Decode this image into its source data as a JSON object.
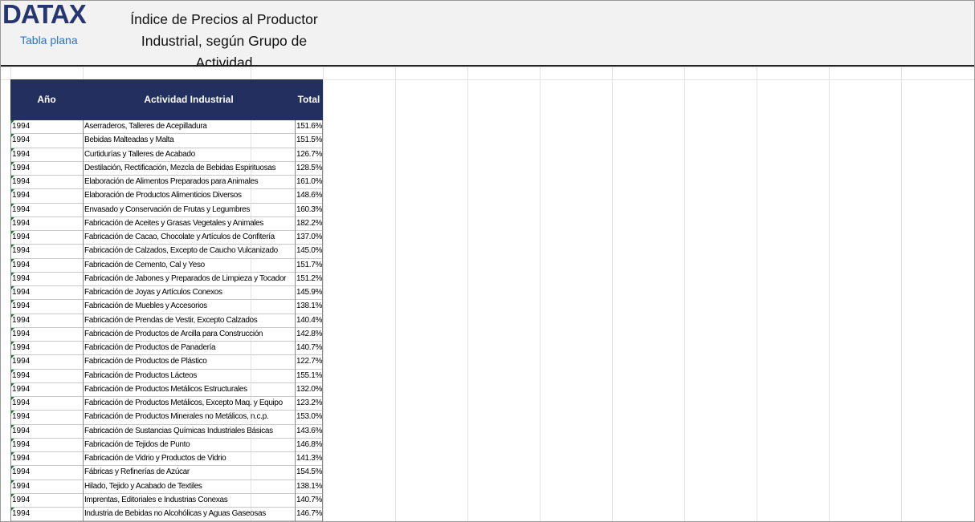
{
  "header": {
    "logo_text": "DATAX",
    "logo_subtitle": "Tabla plana",
    "title_line1": "Índice de Precios al Productor",
    "title_line2": "Industrial, según Grupo de Actividad"
  },
  "colors": {
    "header_band": "#f2f2f2",
    "table_header_bg": "#23305f",
    "logo_color": "#253670",
    "subtitle_color": "#2f71b7",
    "cell_marker": "#1e7a35"
  },
  "table": {
    "columns": [
      "Año",
      "Actividad Industrial",
      "Total"
    ],
    "rows": [
      {
        "year": "1994",
        "activity": "Aserraderos, Talleres de Acepilladura",
        "total": "151.6%"
      },
      {
        "year": "1994",
        "activity": "Bebidas Malteadas y Malta",
        "total": "151.5%"
      },
      {
        "year": "1994",
        "activity": "Curtidurías y Talleres de Acabado",
        "total": "126.7%"
      },
      {
        "year": "1994",
        "activity": "Destilación, Rectificación, Mezcla de Bebidas Espirituosas",
        "total": "128.5%"
      },
      {
        "year": "1994",
        "activity": "Elaboración de Alimentos Preparados para Animales",
        "total": "161.0%"
      },
      {
        "year": "1994",
        "activity": "Elaboración de Productos Alimenticios Diversos",
        "total": "148.6%"
      },
      {
        "year": "1994",
        "activity": "Envasado y Conservación de Frutas y Legumbres",
        "total": "160.3%"
      },
      {
        "year": "1994",
        "activity": "Fabricación de Aceites y Grasas Vegetales y Animales",
        "total": "182.2%"
      },
      {
        "year": "1994",
        "activity": "Fabricación de Cacao, Chocolate y Artículos de Confitería",
        "total": "137.0%"
      },
      {
        "year": "1994",
        "activity": "Fabricación de Calzados, Excepto de Caucho Vulcanizado",
        "total": "145.0%"
      },
      {
        "year": "1994",
        "activity": "Fabricación de Cemento, Cal y Yeso",
        "total": "151.7%"
      },
      {
        "year": "1994",
        "activity": "Fabricación de Jabones y Preparados de Limpieza y Tocador",
        "total": "151.2%"
      },
      {
        "year": "1994",
        "activity": "Fabricación de Joyas y Artículos Conexos",
        "total": "145.9%"
      },
      {
        "year": "1994",
        "activity": "Fabricación de Muebles y Accesorios",
        "total": "138.1%"
      },
      {
        "year": "1994",
        "activity": "Fabricación de Prendas de Vestir, Excepto Calzados",
        "total": "140.4%"
      },
      {
        "year": "1994",
        "activity": "Fabricación de Productos de Arcilla para Construcción",
        "total": "142.8%"
      },
      {
        "year": "1994",
        "activity": "Fabricación de Productos de Panadería",
        "total": "140.7%"
      },
      {
        "year": "1994",
        "activity": "Fabricación de Productos de Plástico",
        "total": "122.7%"
      },
      {
        "year": "1994",
        "activity": "Fabricación de Productos Lácteos",
        "total": "155.1%"
      },
      {
        "year": "1994",
        "activity": "Fabricación de Productos Metálicos Estructurales",
        "total": "132.0%"
      },
      {
        "year": "1994",
        "activity": "Fabricación de Productos Metálicos, Excepto Maq. y Equipo",
        "total": "123.2%"
      },
      {
        "year": "1994",
        "activity": "Fabricación de Productos Minerales no Metálicos, n.c.p.",
        "total": "153.0%"
      },
      {
        "year": "1994",
        "activity": "Fabricación de Sustancias Químicas Industriales Básicas",
        "total": "143.6%"
      },
      {
        "year": "1994",
        "activity": "Fabricación de Tejidos de Punto",
        "total": "146.8%"
      },
      {
        "year": "1994",
        "activity": "Fabricación de Vidrio y Productos de Vidrio",
        "total": "141.3%"
      },
      {
        "year": "1994",
        "activity": "Fábricas y Refinerías de Azúcar",
        "total": "154.5%"
      },
      {
        "year": "1994",
        "activity": "Hilado, Tejido y Acabado de Textiles",
        "total": "138.1%"
      },
      {
        "year": "1994",
        "activity": "Imprentas, Editoriales e Industrias Conexas",
        "total": "140.7%"
      },
      {
        "year": "1994",
        "activity": "Industria de Bebidas no Alcohólicas y Aguas Gaseosas",
        "total": "146.7%"
      }
    ]
  }
}
